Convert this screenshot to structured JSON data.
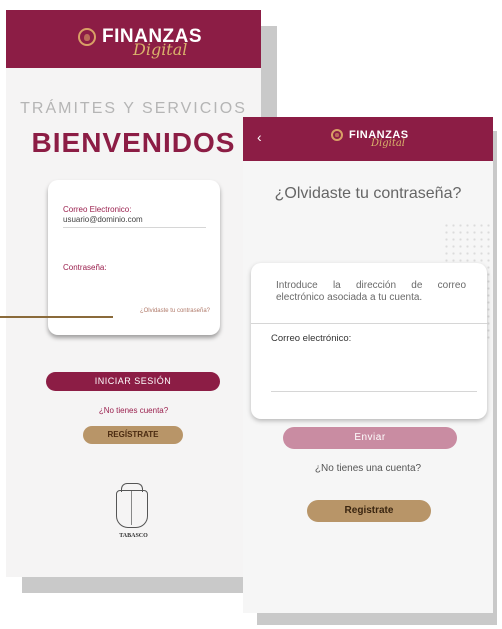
{
  "login_screen": {
    "brand": "FINANZAS",
    "brand_script": "Digital",
    "subtitle": "TRÁMITES Y SERVICIOS",
    "title": "BIENVENIDOS",
    "email_label": "Correo Electronico:",
    "email_value": "usuario@dominio.com",
    "password_label": "Contraseña:",
    "forgot_link": "¿Olvidaste tu contraseña?",
    "login_button": "INICIAR SESIÓN",
    "no_account": "¿No tienes cuenta?",
    "register_button": "REGÍSTRATE",
    "crest_label": "TABASCO"
  },
  "forgot_screen": {
    "back": "‹",
    "brand": "FINANZAS",
    "brand_script": "Digital",
    "title": "¿Olvidaste tu contraseña?",
    "instructions": "Introduce la dirección de correo electrónico asociada a tu cuenta.",
    "email_label": "Correo electrónico:",
    "send_button": "Enviar",
    "no_account": "¿No tienes una cuenta?",
    "register_button": "Registrate"
  },
  "colors": {
    "brand_primary": "#8c1d45",
    "brand_gold": "#b89568",
    "send_disabled": "#c98ca2"
  },
  "icons": {
    "logo": "finanzas-emblem-icon",
    "back": "back-arrow-icon",
    "crest": "tabasco-crest-icon"
  }
}
